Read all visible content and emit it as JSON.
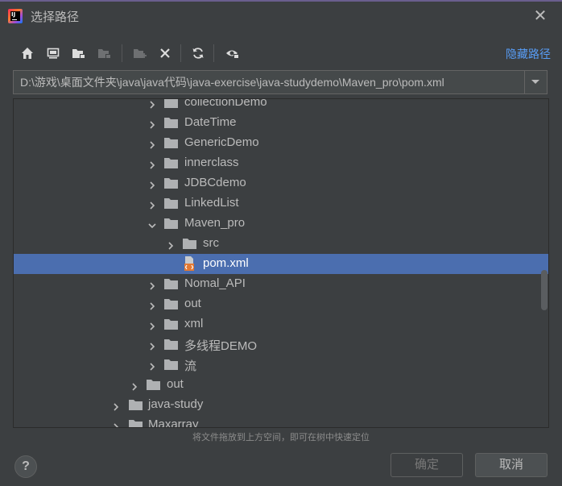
{
  "window": {
    "title": "选择路径",
    "close_label": "✕"
  },
  "toolbar": {
    "buttons": [
      {
        "name": "home-icon"
      },
      {
        "name": "desktop-icon"
      },
      {
        "name": "project-folder-icon"
      },
      {
        "name": "module-folder-icon"
      },
      {
        "name": "new-folder-icon"
      },
      {
        "name": "delete-icon"
      },
      {
        "name": "refresh-icon"
      },
      {
        "name": "show-hidden-icon"
      }
    ],
    "hide_path_label": "隐藏路径"
  },
  "path_field": {
    "value": "D:\\游戏\\桌面文件夹\\java\\java代码\\java-exercise\\java-studydemo\\Maven_pro\\pom.xml"
  },
  "tree": {
    "items": [
      {
        "label": "collectionDemo",
        "type": "folder",
        "expanded": false,
        "selected": false
      },
      {
        "label": "DateTime",
        "type": "folder",
        "expanded": false,
        "selected": false
      },
      {
        "label": "GenericDemo",
        "type": "folder",
        "expanded": false,
        "selected": false
      },
      {
        "label": "innerclass",
        "type": "folder",
        "expanded": false,
        "selected": false
      },
      {
        "label": "JDBCdemo",
        "type": "folder",
        "expanded": false,
        "selected": false
      },
      {
        "label": "LinkedList",
        "type": "folder",
        "expanded": false,
        "selected": false
      },
      {
        "label": "Maven_pro",
        "type": "folder",
        "expanded": true,
        "selected": false
      },
      {
        "label": "src",
        "type": "folder",
        "expanded": false,
        "selected": false
      },
      {
        "label": "pom.xml",
        "type": "file",
        "expanded": false,
        "selected": true
      },
      {
        "label": "Nomal_API",
        "type": "folder",
        "expanded": false,
        "selected": false
      },
      {
        "label": "out",
        "type": "folder",
        "expanded": false,
        "selected": false
      },
      {
        "label": "xml",
        "type": "folder",
        "expanded": false,
        "selected": false
      },
      {
        "label": "多线程DEMO",
        "type": "folder",
        "expanded": false,
        "selected": false
      },
      {
        "label": "流",
        "type": "folder",
        "expanded": false,
        "selected": false
      },
      {
        "label": "out",
        "type": "folder",
        "expanded": false,
        "selected": false
      },
      {
        "label": "java-study",
        "type": "folder",
        "expanded": false,
        "selected": false
      },
      {
        "label": "Maxarray",
        "type": "folder",
        "expanded": false,
        "selected": false
      }
    ]
  },
  "footer": {
    "drop_hint": "将文件拖放到上方空间，即可在树中快速定位",
    "help_label": "?",
    "ok_label": "确定",
    "cancel_label": "取消"
  },
  "colors": {
    "background": "#3c3f41",
    "selection": "#4b6eaf",
    "link": "#589df6",
    "folder": "#afb1b3",
    "xml_file": "#e37933"
  }
}
